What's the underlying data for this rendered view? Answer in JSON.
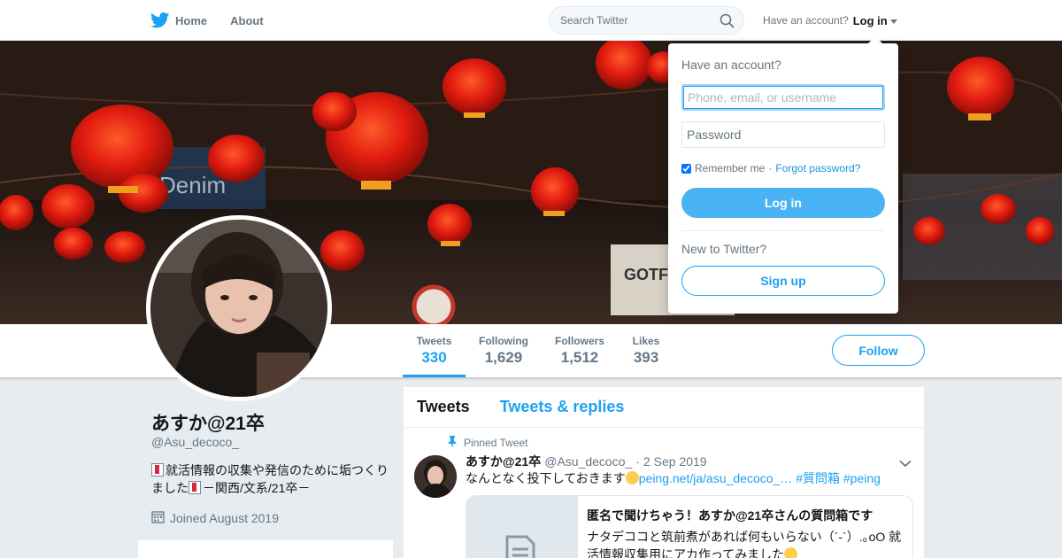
{
  "nav": {
    "home_label": "Home",
    "about_label": "About",
    "search_placeholder": "Search Twitter",
    "have_account": "Have an account?",
    "login_label": "Log in"
  },
  "login_dropdown": {
    "title": "Have an account?",
    "username_placeholder": "Phone, email, or username",
    "password_placeholder": "Password",
    "remember_label": "Remember me",
    "separator": "·",
    "forgot_label": "Forgot password?",
    "remember_checked": true,
    "login_button": "Log in",
    "new_prompt": "New to Twitter?",
    "signup_button": "Sign up"
  },
  "stats": [
    {
      "label": "Tweets",
      "value": "330",
      "active": true
    },
    {
      "label": "Following",
      "value": "1,629",
      "active": false
    },
    {
      "label": "Followers",
      "value": "1,512",
      "active": false
    },
    {
      "label": "Likes",
      "value": "393",
      "active": false
    }
  ],
  "follow_button": "Follow",
  "profile": {
    "name": "あすか@21卒",
    "handle": "@Asu_decoco_",
    "bio_part1": "就活情報の収集や発信のために垢つくりました",
    "bio_part2": "－関西/文系/21卒－",
    "joined": "Joined August 2019"
  },
  "timeline": {
    "tabs": [
      "Tweets",
      "Tweets & replies"
    ],
    "pinned_label": "Pinned Tweet",
    "tweet": {
      "name": "あすか@21卒",
      "handle": "@Asu_decoco_",
      "separator": "·",
      "date": "2 Sep 2019",
      "text": "なんとなく投下しておきます",
      "link": "peing.net/ja/asu_decoco_…",
      "hashtags": "#質問箱 #peing",
      "card_title": "匿名で聞けちゃう！あすか@21卒さんの質問箱です",
      "card_desc_part1": "ナタデココと筑前煮があれば何もいらない（´-`）.｡oO 就活情報収集用にアカ作ってみました"
    }
  },
  "colors": {
    "accent": "#1da1f2",
    "login_button": "#4ab3f4",
    "background": "#e6ecf0"
  }
}
